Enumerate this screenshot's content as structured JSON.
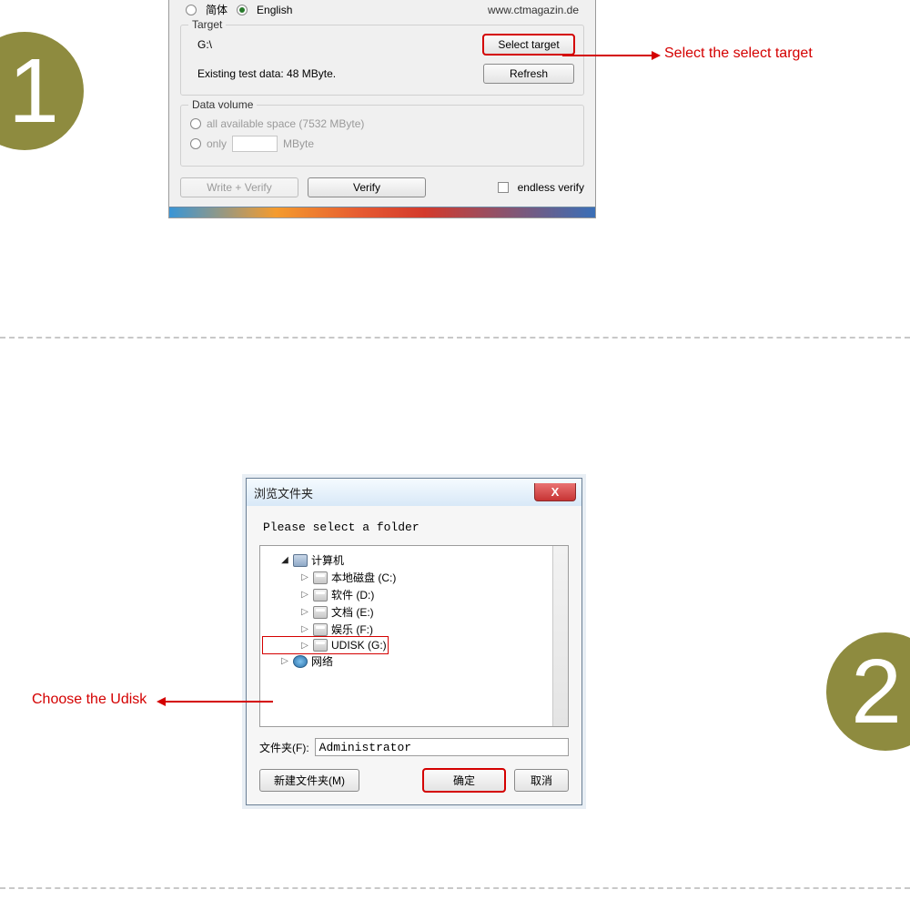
{
  "steps": {
    "one": "1",
    "two": "2"
  },
  "step1": {
    "lang1": "简体",
    "lang2": "English",
    "url": "www.ctmagazin.de",
    "target_group": "Target",
    "target_path": "G:\\",
    "select_target": "Select target",
    "existing": "Existing test data: 48 MByte.",
    "refresh": "Refresh",
    "data_volume": "Data volume",
    "all_space": "all available space (7532 MByte)",
    "only": "only",
    "mbyte": "MByte",
    "write_verify": "Write + Verify",
    "verify": "Verify",
    "endless": "endless verify",
    "annotation": "Select the select target"
  },
  "step2": {
    "title": "浏览文件夹",
    "close": "X",
    "prompt": "Please select a folder",
    "tree": {
      "computer": "计算机",
      "c": "本地磁盘 (C:)",
      "d": "软件 (D:)",
      "e": "文档 (E:)",
      "f": "娱乐 (F:)",
      "g": "UDISK (G:)",
      "network": "网络"
    },
    "folder_label": "文件夹(F):",
    "folder_value": "Administrator",
    "new_folder": "新建文件夹(M)",
    "ok": "确定",
    "cancel": "取消",
    "annotation": "Choose the Udisk"
  }
}
